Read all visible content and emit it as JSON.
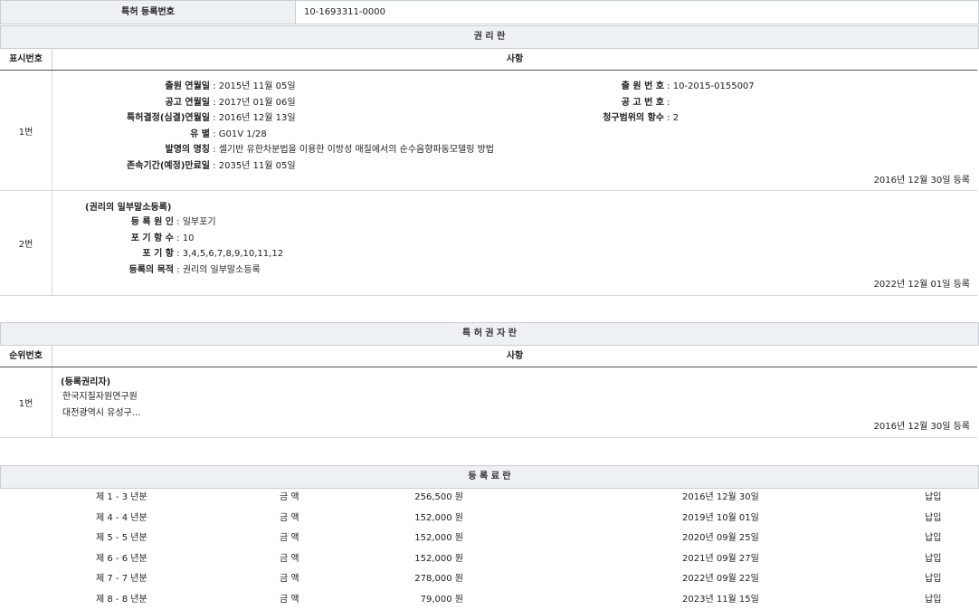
{
  "top": {
    "label": "특허 등록번호",
    "value": "10-1693311-0000"
  },
  "rights": {
    "title": "권 리 란",
    "col_num": "표시번호",
    "col_content": "사항",
    "row1": {
      "num": "1번",
      "left": [
        {
          "k": "출원 연월일",
          "v": "2015년 11월 05일"
        },
        {
          "k": "공고 연월일",
          "v": "2017년 01월 06일"
        },
        {
          "k": "특허결정(심결)연월일",
          "v": "2016년 12월 13일"
        },
        {
          "k": "유 별",
          "v": "G01V 1/28"
        },
        {
          "k": "발명의 명칭",
          "v": "셀기반 유한차분법을 이용한 이방성 매질에서의 순수음향파동모델링 방법"
        },
        {
          "k": "존속기간(예정)만료일",
          "v": "2035년 11월 05일"
        }
      ],
      "right": [
        {
          "k": "출 원 번 호",
          "v": "10-2015-0155007"
        },
        {
          "k": "공 고 번 호",
          "v": ""
        },
        {
          "k": "청구범위의 항수",
          "v": "2"
        }
      ],
      "date": "2016년 12월 30일 등록"
    },
    "row2": {
      "num": "2번",
      "heading": "(권리의 일부말소등록)",
      "items": [
        {
          "k": "등 록 원 인",
          "v": "일부포기"
        },
        {
          "k": "포 기 항 수",
          "v": "10"
        },
        {
          "k": "포 기 항",
          "v": "3,4,5,6,7,8,9,10,11,12"
        },
        {
          "k": "등록의 목적",
          "v": "권리의 일부말소등록"
        }
      ],
      "date": "2022년 12월 01일 등록"
    }
  },
  "holder": {
    "title": "특 허 권 자 란",
    "col_num": "순위번호",
    "col_content": "사항",
    "row1": {
      "num": "1번",
      "lines": [
        "(등록권리자)",
        "한국지질자원연구원",
        "대전광역시 유성구..."
      ],
      "date": "2016년 12월 30일 등록"
    }
  },
  "fees": {
    "title": "등 록 료 란",
    "rows": [
      {
        "period": "제 1 - 3 년분",
        "label": "금 액",
        "amount": "256,500 원",
        "date": "2016년 12월 30일",
        "status": "납입"
      },
      {
        "period": "제 4 - 4 년분",
        "label": "금 액",
        "amount": "152,000 원",
        "date": "2019년 10월 01일",
        "status": "납입"
      },
      {
        "period": "제 5 - 5 년분",
        "label": "금 액",
        "amount": "152,000 원",
        "date": "2020년 09월 25일",
        "status": "납입"
      },
      {
        "period": "제 6 - 6 년분",
        "label": "금 액",
        "amount": "152,000 원",
        "date": "2021년 09월 27일",
        "status": "납입"
      },
      {
        "period": "제 7 - 7 년분",
        "label": "금 액",
        "amount": "278,000 원",
        "date": "2022년 09월 22일",
        "status": "납입"
      },
      {
        "period": "제 8 - 8 년분",
        "label": "금 액",
        "amount": "79,000 원",
        "date": "2023년 11월 15일",
        "status": "납입"
      }
    ]
  }
}
